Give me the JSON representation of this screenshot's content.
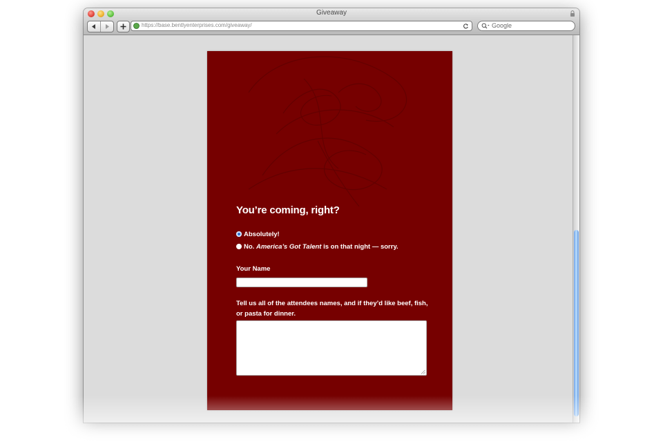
{
  "window": {
    "title": "Giveaway"
  },
  "toolbar": {
    "url": "https://base.bentlyenterprises.com/giveaway/",
    "search_placeholder": "Google"
  },
  "form": {
    "heading": "You’re coming, right?",
    "option_yes": "Absolutely!",
    "option_no_prefix": "No.",
    "option_no_show": "America’s Got Talent",
    "option_no_suffix": "is on that night — sorry.",
    "name_label": "Your Name",
    "attendees_label": "Tell us all of the attendees names, and if they’d like beef, fish, or pasta for dinner.",
    "selected_option": "Absolutely!"
  },
  "colors": {
    "panel_bg": "#760000",
    "page_bg": "#dcdcdc",
    "scroll_thumb": "#6fa1e6"
  }
}
